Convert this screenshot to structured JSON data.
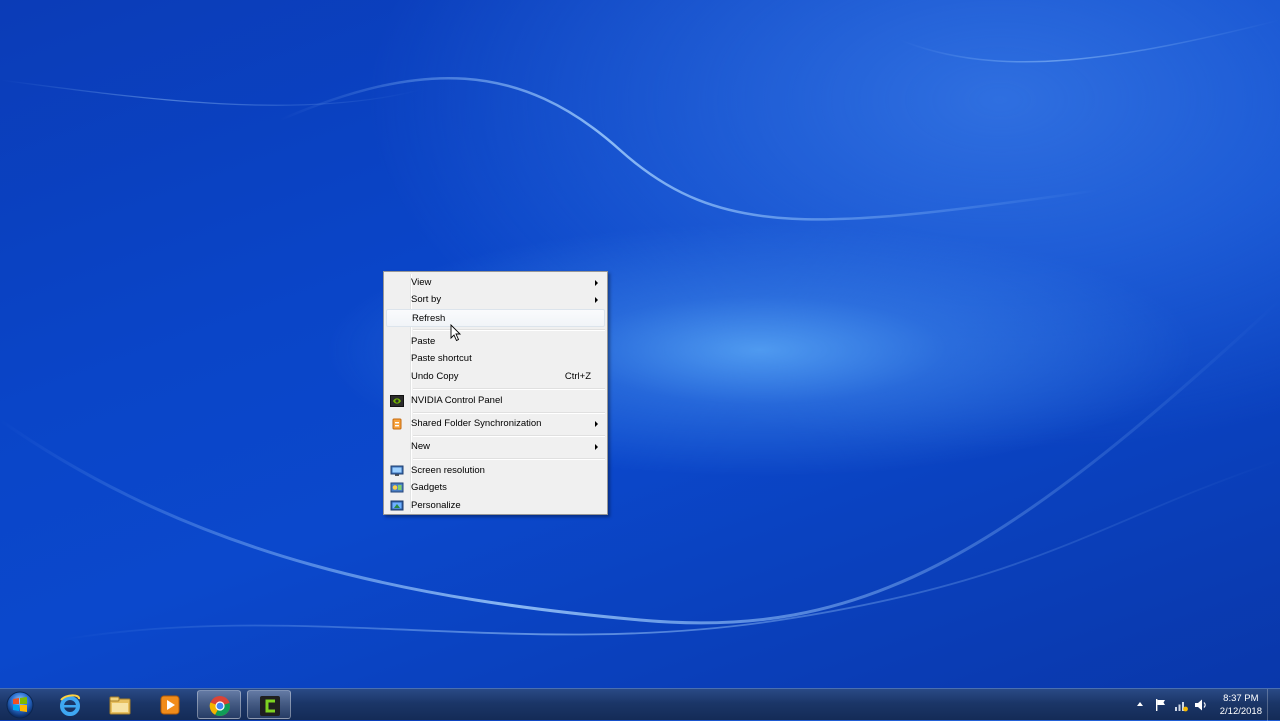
{
  "context_menu": {
    "items": [
      {
        "label": "View",
        "submenu": true
      },
      {
        "label": "Sort by",
        "submenu": true
      },
      {
        "label": "Refresh",
        "highlighted": true
      },
      {
        "label": "Paste"
      },
      {
        "label": "Paste shortcut"
      },
      {
        "label": "Undo Copy",
        "shortcut": "Ctrl+Z"
      },
      {
        "label": "NVIDIA Control Panel",
        "icon": "nvidia-icon"
      },
      {
        "label": "Shared Folder Synchronization",
        "icon": "shared-folder-sync-icon",
        "submenu": true
      },
      {
        "label": "New",
        "submenu": true
      },
      {
        "label": "Screen resolution",
        "icon": "screen-resolution-icon"
      },
      {
        "label": "Gadgets",
        "icon": "gadgets-icon"
      },
      {
        "label": "Personalize",
        "icon": "personalize-icon"
      }
    ]
  },
  "taskbar": {
    "pinned": [
      {
        "name": "internet-explorer-icon"
      },
      {
        "name": "windows-explorer-icon"
      },
      {
        "name": "media-player-icon"
      },
      {
        "name": "chrome-icon",
        "active": true
      },
      {
        "name": "camtasia-icon",
        "active": true
      }
    ],
    "clock": {
      "time": "8:37 PM",
      "date": "2/12/2018"
    }
  },
  "colors": {
    "desktop_blue": "#0b45c8",
    "menu_bg": "#f0f0f0",
    "taskbar": "#1b3668"
  }
}
